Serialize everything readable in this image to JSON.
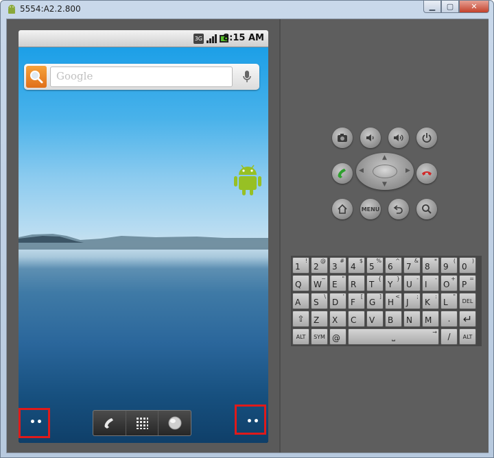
{
  "window": {
    "title": "5554:A2.2.800",
    "minimize_icon": "minimize-icon",
    "maximize_icon": "maximize-icon",
    "close_icon": "close-icon"
  },
  "status_bar": {
    "network_label": "3G",
    "time": "8:15",
    "time_suffix": "AM"
  },
  "search_widget": {
    "placeholder": "Google"
  },
  "dock": {
    "items": [
      "phone-icon",
      "apps-grid-icon",
      "browser-globe-icon"
    ]
  },
  "hardware_buttons": {
    "menu_label": "MENU"
  },
  "keyboard": {
    "rows": [
      [
        {
          "main": "1",
          "sub": "!"
        },
        {
          "main": "2",
          "sub": "@"
        },
        {
          "main": "3",
          "sub": "#"
        },
        {
          "main": "4",
          "sub": "$"
        },
        {
          "main": "5",
          "sub": "%"
        },
        {
          "main": "6",
          "sub": "^"
        },
        {
          "main": "7",
          "sub": "&"
        },
        {
          "main": "8",
          "sub": "*"
        },
        {
          "main": "9",
          "sub": "("
        },
        {
          "main": "0",
          "sub": ")"
        }
      ],
      [
        {
          "main": "Q",
          "sub": ""
        },
        {
          "main": "W",
          "sub": "~"
        },
        {
          "main": "E",
          "sub": "\""
        },
        {
          "main": "R",
          "sub": ""
        },
        {
          "main": "T",
          "sub": "{"
        },
        {
          "main": "Y",
          "sub": "}"
        },
        {
          "main": "U",
          "sub": "-"
        },
        {
          "main": "I",
          "sub": "-"
        },
        {
          "main": "O",
          "sub": "+"
        },
        {
          "main": "P",
          "sub": "="
        }
      ],
      [
        {
          "main": "A",
          "sub": ""
        },
        {
          "main": "S",
          "sub": "\\"
        },
        {
          "main": "D",
          "sub": "'"
        },
        {
          "main": "F",
          "sub": "["
        },
        {
          "main": "G",
          "sub": "]"
        },
        {
          "main": "H",
          "sub": "<"
        },
        {
          "main": "J",
          "sub": ";"
        },
        {
          "main": "K",
          "sub": ":"
        },
        {
          "main": "L",
          "sub": "\""
        },
        {
          "main": "DEL",
          "sub": ""
        }
      ],
      [
        {
          "main": "⇧",
          "sub": ""
        },
        {
          "main": "Z",
          "sub": ""
        },
        {
          "main": "X",
          "sub": ""
        },
        {
          "main": "C",
          "sub": ""
        },
        {
          "main": "V",
          "sub": ""
        },
        {
          "main": "B",
          "sub": ""
        },
        {
          "main": "N",
          "sub": ""
        },
        {
          "main": "M",
          "sub": ""
        },
        {
          "main": ".",
          "sub": ""
        },
        {
          "main": "↵",
          "sub": ""
        }
      ],
      [
        {
          "main": "ALT",
          "sub": ""
        },
        {
          "main": "SYM",
          "sub": ""
        },
        {
          "main": "@",
          "sub": ""
        },
        {
          "main": "⎵",
          "sub": "→"
        },
        {
          "main": "/",
          "sub": ""
        },
        {
          "main": ",",
          "sub": ""
        },
        {
          "main": "ALT",
          "sub": ""
        }
      ]
    ]
  },
  "colors": {
    "highlight_box": "#e01a1a",
    "search_button": "#f08a2a",
    "android_green": "#97c024"
  }
}
